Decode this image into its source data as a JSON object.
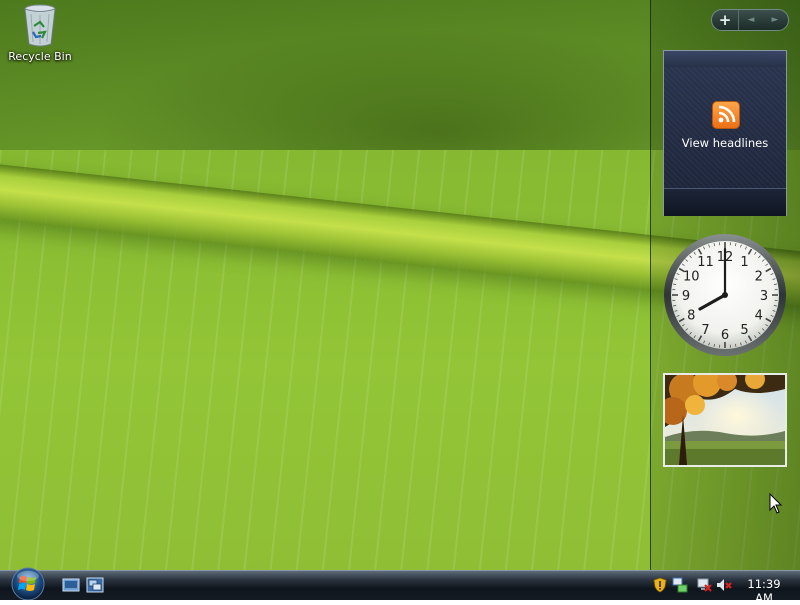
{
  "desktop": {
    "recycle_bin_label": "Recycle Bin"
  },
  "sidebar": {
    "add_button_label": "+",
    "prev_label": "◄",
    "next_label": "►",
    "feed_gadget": {
      "label": "View headlines",
      "icon": "rss-icon"
    },
    "clock_gadget": {
      "numerals": [
        "12",
        "1",
        "2",
        "3",
        "4",
        "5",
        "6",
        "7",
        "8",
        "9",
        "10",
        "11"
      ],
      "time_shown": "8:00"
    },
    "slideshow_gadget": {
      "icon": "photo-thumbnail"
    }
  },
  "taskbar": {
    "quick_launch": [
      "show-desktop-icon",
      "switch-windows-icon"
    ],
    "tray_icons": [
      "shield-warning-icon",
      "network-icon",
      "network-disconnected-icon",
      "volume-muted-icon"
    ],
    "clock": "11:39 AM"
  },
  "colors": {
    "accent_rss": "#ec6f15",
    "wallpaper_green": "#8fc237",
    "taskbar": "#141b22"
  }
}
